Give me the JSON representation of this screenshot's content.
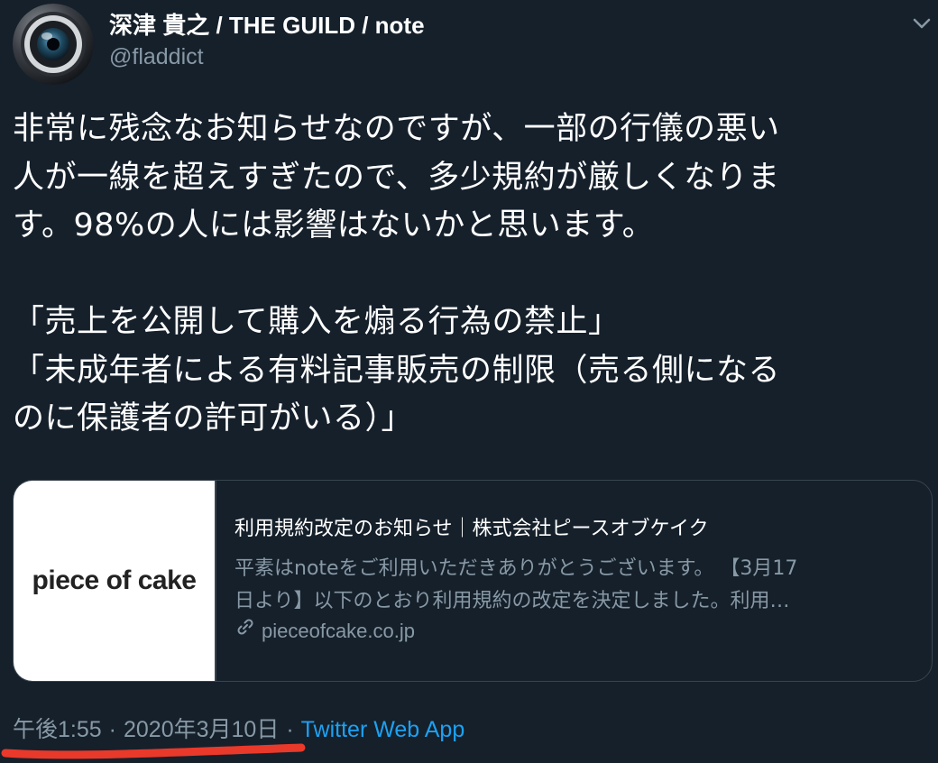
{
  "author": {
    "name": "深津 貴之 / THE GUILD / note",
    "handle": "@fladdict"
  },
  "tweet": {
    "lines": [
      "非常に残念なお知らせなのですが、一部の行儀の悪い",
      "人が一線を超えすぎたので、多少規約が厳しくなりま",
      "す。98%の人には影響はないかと思います。",
      "",
      "「売上を公開して購入を煽る行為の禁止」",
      "「未成年者による有料記事販売の制限（売る側になる",
      "のに保護者の許可がいる）」"
    ]
  },
  "card": {
    "image_text": "piece of cake",
    "title": "利用規約改定のお知らせ｜株式会社ピースオブケイク",
    "desc_line1": "平素はnoteをご利用いただきありがとうございます。 【3月17",
    "desc_line2": "日より】以下のとおり利用規約の改定を決定しました。利用…",
    "domain": "pieceofcake.co.jp"
  },
  "meta": {
    "time": "午後1:55",
    "date": "2020年3月10日",
    "separator": "·",
    "app": "Twitter Web App"
  },
  "colors": {
    "background": "#15202b",
    "text": "#ffffff",
    "secondary": "#8899a6",
    "link": "#1da1f2",
    "border": "#38444d",
    "annotation": "#e8392b"
  },
  "icons": {
    "caret": "chevron-down-icon",
    "link": "link-icon"
  }
}
